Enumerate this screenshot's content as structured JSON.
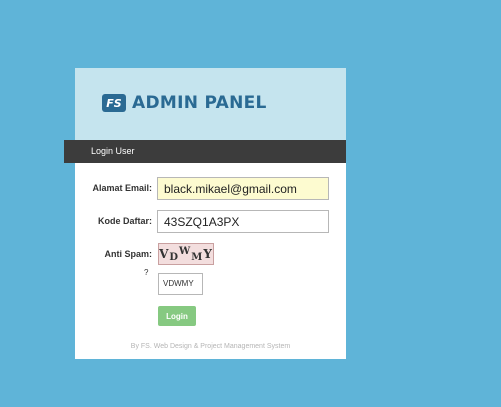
{
  "header": {
    "logo_badge": "FS",
    "title": "ADMIN PANEL"
  },
  "section_bar": {
    "label": "Login User"
  },
  "form": {
    "email_label": "Alamat Email:",
    "email_value": "black.mikael@gmail.com",
    "code_label": "Kode Daftar:",
    "code_value": "43SZQ1A3PX",
    "spam_label": "Anti Spam:",
    "captcha": {
      "c1": "V",
      "c2": "D",
      "c3": "W",
      "c4": "M",
      "c5": "Y"
    },
    "question_mark": "?",
    "spam_answer": "VDWMY",
    "login_label": "Login"
  },
  "footer": {
    "text": "By FS. Web Design & Project Management System"
  },
  "colors": {
    "background": "#5fb4d8",
    "header_bg": "#c5e4ee",
    "brand": "#2a6a93",
    "bar": "#3c3c3c",
    "login_button": "#86c981"
  }
}
